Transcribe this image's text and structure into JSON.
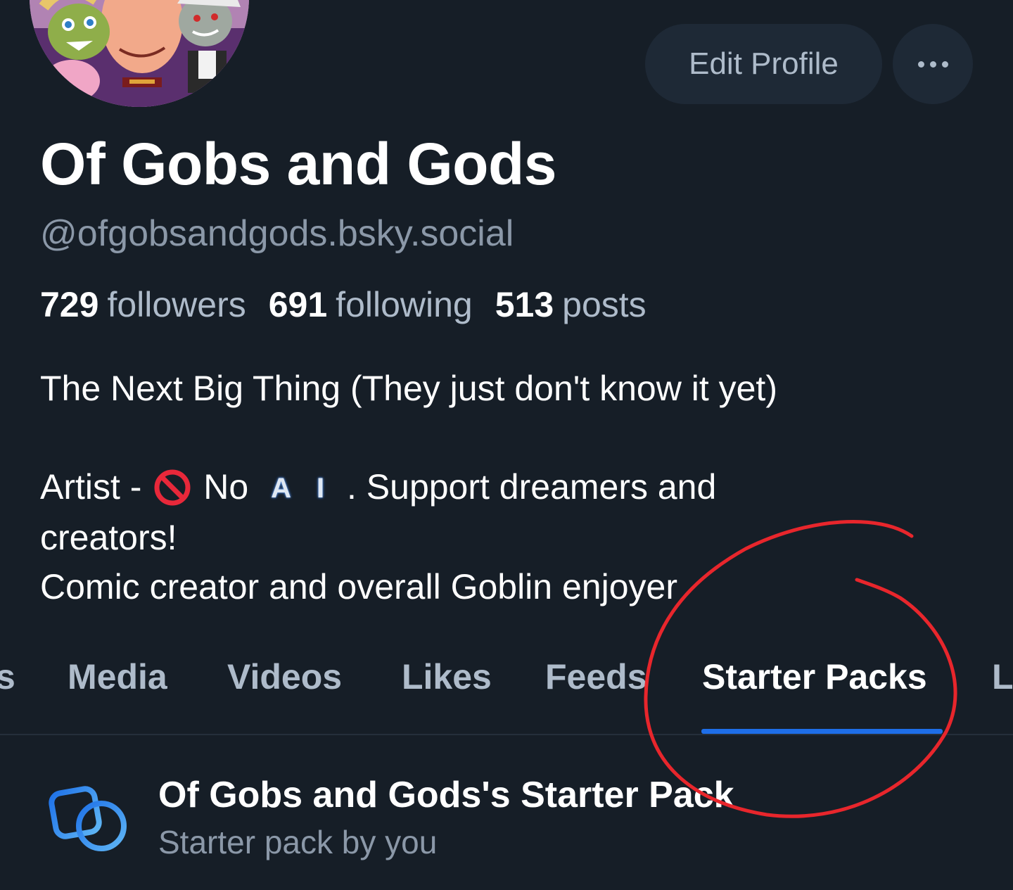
{
  "header": {
    "edit_profile_label": "Edit Profile",
    "more_label": "More options"
  },
  "profile": {
    "display_name": "Of Gobs and Gods",
    "handle": "@ofgobsandgods.bsky.social",
    "stats": {
      "followers_count": "729",
      "followers_label": "followers",
      "following_count": "691",
      "following_label": "following",
      "posts_count": "513",
      "posts_label": "posts"
    },
    "bio": {
      "line1": "The Next Big Thing (They just don't know it yet)",
      "line2_prefix": "Artist -",
      "line2_no": "No",
      "line2_ai_a": "A",
      "line2_ai_i": "I",
      "line2_suffix": ". Support dreamers and",
      "line3": "creators!",
      "line4": "Comic creator and overall Goblin enjoyer"
    }
  },
  "tabs": [
    {
      "label": "s"
    },
    {
      "label": "Media"
    },
    {
      "label": "Videos"
    },
    {
      "label": "Likes"
    },
    {
      "label": "Feeds"
    },
    {
      "label": "Starter Packs",
      "active": true
    },
    {
      "label": "L"
    }
  ],
  "starter_pack": {
    "title": "Of Gobs and Gods's Starter Pack",
    "subtitle": "Starter pack by you",
    "icon": "starter-pack-icon"
  },
  "colors": {
    "background": "#161e27",
    "accent": "#1e6ee8",
    "annotation": "#e8262c",
    "muted_text": "#8b98a8"
  }
}
